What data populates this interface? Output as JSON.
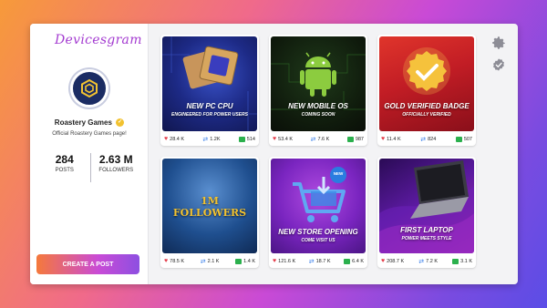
{
  "app": {
    "logo": "Devicesgram"
  },
  "profile": {
    "name": "Roastery Games",
    "bio": "Official Roastery Games page!",
    "posts_count": "284",
    "posts_label": "POSTS",
    "followers_count": "2.63 M",
    "followers_label": "FOLLOWERS"
  },
  "actions": {
    "create_post": "CREATE A POST"
  },
  "icons": {
    "settings": "gear-icon",
    "verified": "verified-badge-icon"
  },
  "colors": {
    "accent": "#a33ad0",
    "like": "#e33b48",
    "share": "#2f79e8",
    "comment": "#2bb04d"
  },
  "posts": [
    {
      "title": "NEW PC CPU",
      "subtitle": "ENGINEERED FOR POWER USERS",
      "likes": "28.4 K",
      "shares": "1.2K",
      "comments": "514"
    },
    {
      "title": "NEW MOBILE OS",
      "subtitle": "COMING SOON",
      "likes": "53.4 K",
      "shares": "7.6 K",
      "comments": "987"
    },
    {
      "title": "GOLD VERIFIED BADGE",
      "subtitle": "OFFICIALLY VERIFIED",
      "likes": "11.4 K",
      "shares": "824",
      "comments": "507"
    },
    {
      "title": "1M FOLLOWERS",
      "title_line2": "FOLLOWERS",
      "title_line1": "1M",
      "subtitle": "",
      "likes": "78.5 K",
      "shares": "2.1 K",
      "comments": "1.4 K"
    },
    {
      "title": "NEW STORE OPENING",
      "subtitle": "COME VISIT US",
      "badge": "NEW",
      "likes": "121.6 K",
      "shares": "18.7 K",
      "comments": "6.4 K"
    },
    {
      "title": "FIRST LAPTOP",
      "subtitle": "POWER MEETS STYLE",
      "likes": "208.7 K",
      "shares": "7.2 K",
      "comments": "3.1 K"
    }
  ]
}
